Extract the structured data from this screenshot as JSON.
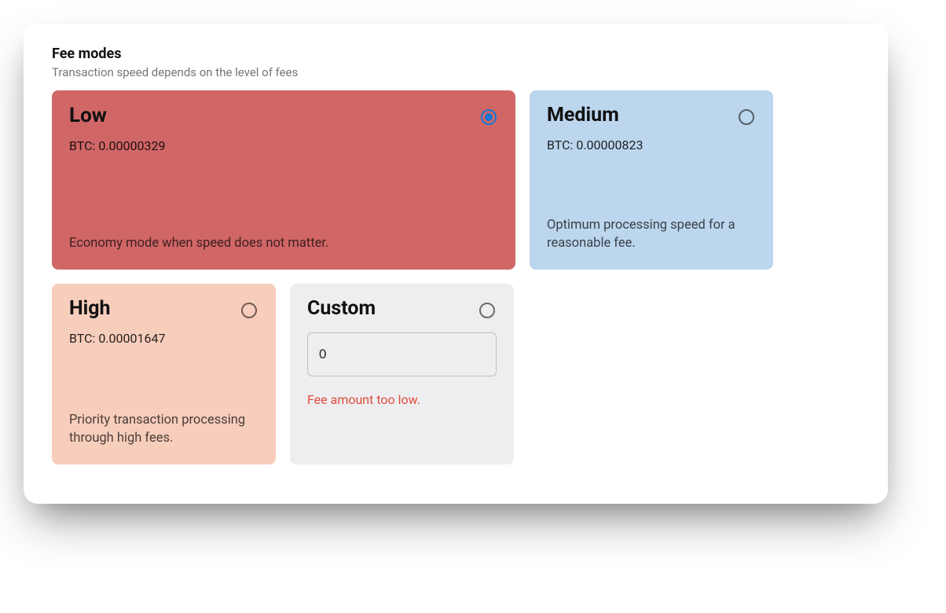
{
  "header": {
    "title": "Fee modes",
    "subtitle": "Transaction speed depends on the level of fees"
  },
  "tiles": {
    "low": {
      "title": "Low",
      "amount": "BTC: 0.00000329",
      "desc": "Economy mode when speed does not matter.",
      "selected": true
    },
    "medium": {
      "title": "Medium",
      "amount": "BTC: 0.00000823",
      "desc": "Optimum processing speed for a reasonable fee.",
      "selected": false
    },
    "high": {
      "title": "High",
      "amount": "BTC: 0.00001647",
      "desc": "Priority transaction processing through high fees.",
      "selected": false
    },
    "custom": {
      "title": "Custom",
      "input_value": "0",
      "error": "Fee amount too low.",
      "selected": false
    }
  },
  "colors": {
    "low_bg": "#d16667",
    "medium_bg": "#bcd6ee",
    "high_bg": "#f7cdbb",
    "custom_bg": "#eeeef0",
    "radio_selected": "#1976d2",
    "error": "#e04b3a"
  }
}
